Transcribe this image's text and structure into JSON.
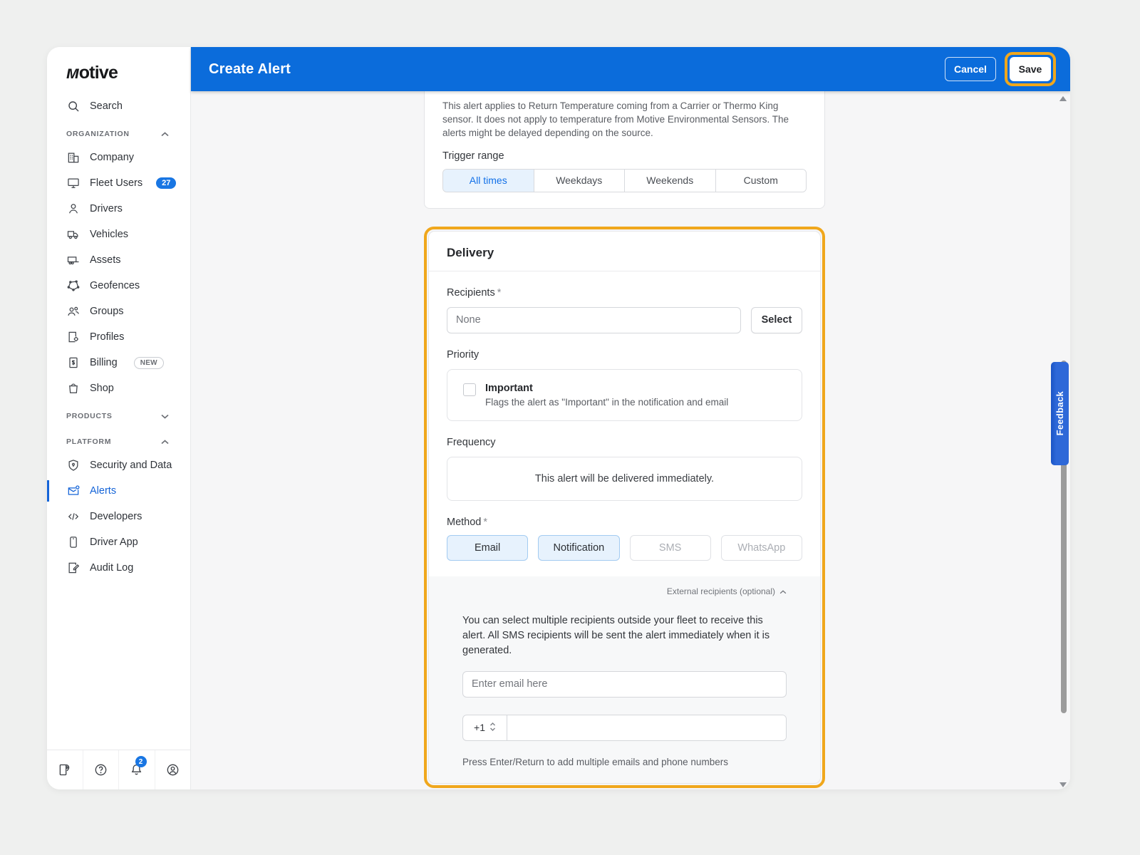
{
  "header": {
    "title": "Create Alert",
    "cancel_label": "Cancel",
    "save_label": "Save"
  },
  "sidebar": {
    "logo": "motive",
    "search_label": "Search",
    "org_section": "ORGANIZATION",
    "org_items": [
      {
        "label": "Company"
      },
      {
        "label": "Fleet Users",
        "badge": "27"
      },
      {
        "label": "Drivers"
      },
      {
        "label": "Vehicles"
      },
      {
        "label": "Assets"
      },
      {
        "label": "Geofences"
      },
      {
        "label": "Groups"
      },
      {
        "label": "Profiles"
      },
      {
        "label": "Billing",
        "tag": "NEW"
      },
      {
        "label": "Shop"
      }
    ],
    "products_section": "PRODUCTS",
    "platform_section": "PLATFORM",
    "platform_items": [
      {
        "label": "Security and Data"
      },
      {
        "label": "Alerts",
        "active": true
      },
      {
        "label": "Developers"
      },
      {
        "label": "Driver App"
      },
      {
        "label": "Audit Log"
      }
    ],
    "notifications_badge": "2"
  },
  "content": {
    "notice": "This alert applies to Return Temperature coming from a Carrier or Thermo King sensor. It does not apply to temperature from Motive Environmental Sensors. The alerts might be delayed depending on the source.",
    "trigger_range_label": "Trigger range",
    "trigger_options": [
      {
        "label": "All times"
      },
      {
        "label": "Weekdays"
      },
      {
        "label": "Weekends"
      },
      {
        "label": "Custom"
      }
    ],
    "trigger_selected": "All times"
  },
  "delivery": {
    "title": "Delivery",
    "recipients_label": "Recipients",
    "required_mark": "*",
    "recipients_value": "None",
    "select_button": "Select",
    "priority_label": "Priority",
    "important_label": "Important",
    "important_desc": "Flags the alert as \"Important\" in the notification and email",
    "frequency_label": "Frequency",
    "frequency_text": "This alert will be delivered immediately.",
    "method_label": "Method",
    "methods": [
      {
        "label": "Email",
        "state": "selected"
      },
      {
        "label": "Notification",
        "state": "selected"
      },
      {
        "label": "SMS",
        "state": "disabled"
      },
      {
        "label": "WhatsApp",
        "state": "disabled"
      }
    ],
    "external_toggle": "External recipients (optional)",
    "external_desc": "You can select multiple recipients outside your fleet to receive this alert. All SMS recipients will be sent the alert immediately when it is generated.",
    "email_placeholder": "Enter email here",
    "phone_country": "+1",
    "hint": "Press Enter/Return to add multiple emails and phone numbers"
  },
  "feedback_tab": "Feedback",
  "colors": {
    "header_blue": "#0b6cdb",
    "accent_blue": "#1464d8",
    "highlight_orange": "#f0a71c",
    "selected_blue_bg": "#e7f2fd"
  }
}
